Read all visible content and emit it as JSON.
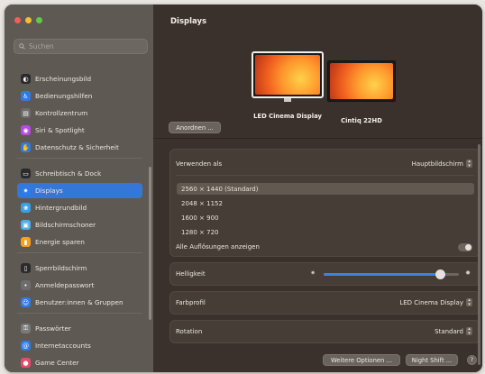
{
  "window": {
    "traffic_lights": {
      "close": "#ee5f57",
      "minimize": "#f3be2f",
      "zoom": "#5fcb46"
    }
  },
  "sidebar": {
    "search_placeholder": "Suchen",
    "items": [
      {
        "label": "Erscheinungsbild",
        "icon": "appearance-icon",
        "color": "#2b2b2b",
        "selected": false
      },
      {
        "label": "Bedienungshilfen",
        "icon": "accessibility-icon",
        "color": "#2f7be6",
        "selected": false
      },
      {
        "label": "Kontrollzentrum",
        "icon": "control-center-icon",
        "color": "#6d6d6d",
        "selected": false
      },
      {
        "label": "Siri & Spotlight",
        "icon": "siri-icon",
        "color": "#b64be0",
        "selected": false
      },
      {
        "label": "Datenschutz & Sicherheit",
        "icon": "privacy-hand-icon",
        "color": "#2f7be6",
        "selected": false
      },
      {
        "label": "Schreibtisch & Dock",
        "icon": "dock-icon",
        "color": "#2b2b2b",
        "selected": false
      },
      {
        "label": "Displays",
        "icon": "displays-icon",
        "color": "#2f7be6",
        "selected": true
      },
      {
        "label": "Hintergrundbild",
        "icon": "wallpaper-icon",
        "color": "#3aa0e6",
        "selected": false
      },
      {
        "label": "Bildschirmschoner",
        "icon": "screensaver-icon",
        "color": "#4fb0e8",
        "selected": false
      },
      {
        "label": "Energie sparen",
        "icon": "battery-icon",
        "color": "#f2a21f",
        "selected": false
      },
      {
        "label": "Sperrbildschirm",
        "icon": "lock-screen-icon",
        "color": "#2b2b2b",
        "selected": false
      },
      {
        "label": "Anmeldepasswort",
        "icon": "login-password-icon",
        "color": "#6d6d6d",
        "selected": false
      },
      {
        "label": "Benutzer:innen & Gruppen",
        "icon": "users-groups-icon",
        "color": "#2f7be6",
        "selected": false
      },
      {
        "label": "Passwörter",
        "icon": "key-icon",
        "color": "#7a7a7a",
        "selected": false
      },
      {
        "label": "Internetaccounts",
        "icon": "at-sign-icon",
        "color": "#2f7be6",
        "selected": false
      },
      {
        "label": "Game Center",
        "icon": "game-center-icon",
        "color": "#e64b6d",
        "selected": false
      }
    ]
  },
  "main": {
    "title": "Displays",
    "arrange_button": "Anordnen ...",
    "displays": [
      {
        "name": "LED Cinema Display",
        "selected": true
      },
      {
        "name": "Cintiq 22HD",
        "selected": false
      }
    ],
    "use_as": {
      "label": "Verwenden als",
      "value": "Hauptbildschirm"
    },
    "resolutions": [
      "2560 × 1440 (Standard)",
      "2048 × 1152",
      "1600 × 900",
      "1280 × 720"
    ],
    "selected_resolution_index": 0,
    "show_all": {
      "label": "Alle Auflösungen anzeigen",
      "enabled": false
    },
    "brightness": {
      "label": "Helligkeit",
      "level": 0.86
    },
    "color_profile": {
      "label": "Farbprofil",
      "value": "LED Cinema Display"
    },
    "rotation": {
      "label": "Rotation",
      "value": "Standard"
    },
    "more_options_button": "Weitere Optionen ...",
    "night_shift_button": "Night Shift ...",
    "help_button": "?"
  }
}
